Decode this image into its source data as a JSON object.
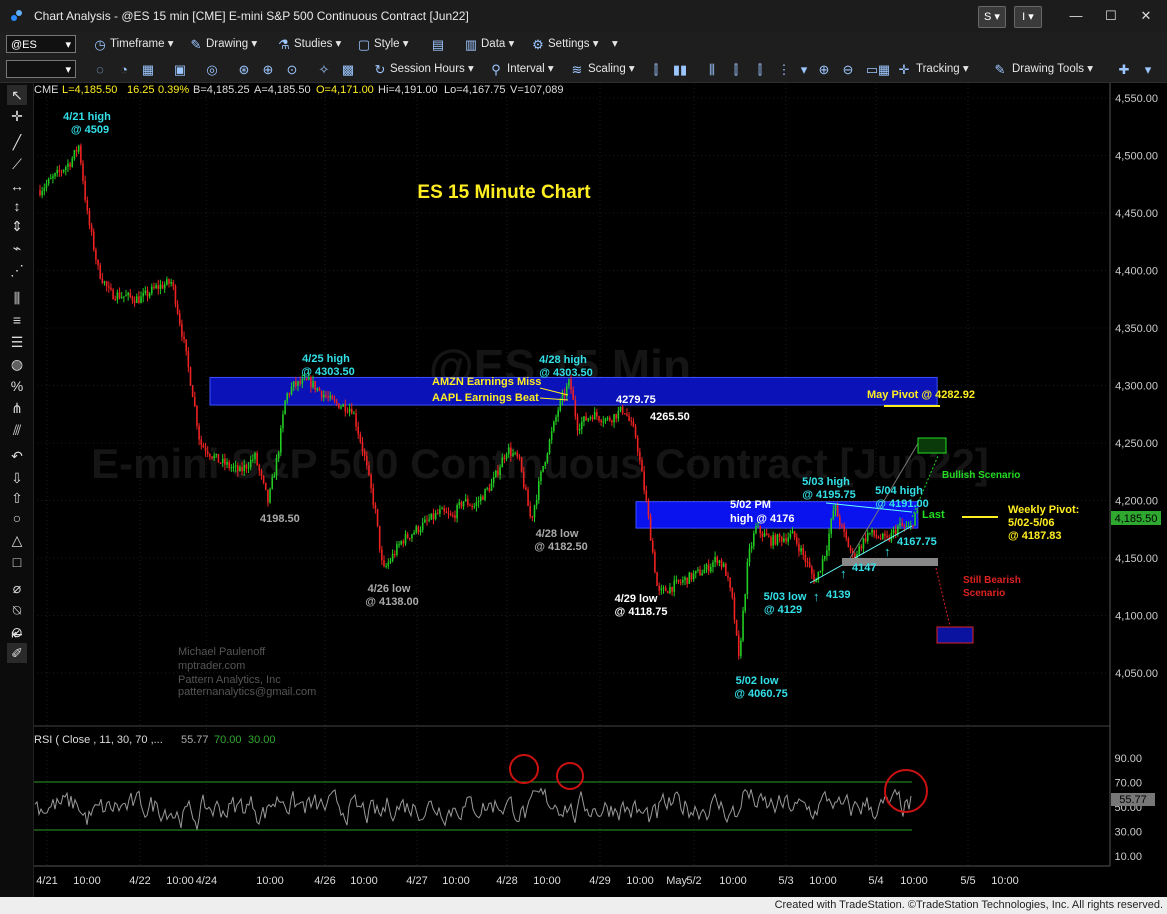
{
  "window": {
    "title": "Chart Analysis - @ES 15 min [CME] E-mini S&P 500 Continuous Contract [Jun22]",
    "s_button": "S",
    "i_button": "I"
  },
  "toolbar1": {
    "symbol": "@ES",
    "timeframe": "Timeframe",
    "drawing": "Drawing",
    "studies": "Studies",
    "style": "Style",
    "data": "Data",
    "settings": "Settings"
  },
  "toolbar2": {
    "session_hours": "Session Hours",
    "interval": "Interval",
    "scaling": "Scaling",
    "tracking": "Tracking",
    "drawing_tools": "Drawing Tools"
  },
  "quote_line": {
    "exchange": "CME",
    "last": "L=4,185.50",
    "change": "16.25",
    "change_pct": "0.39%",
    "bid": "B=4,185.25",
    "ask": "A=4,185.50",
    "open": "O=4,171.00",
    "high": "Hi=4,191.00",
    "low": "Lo=4,167.75",
    "volume": "V=107,089"
  },
  "watermark": {
    "symbol": "@ES 15 Min",
    "name": "E-mini S&P 500 Continuous Contract [Jun22]"
  },
  "author": {
    "line1": "Michael Paulenoff",
    "line2": "mptrader.com",
    "line3": "Pattern Analytics, Inc",
    "line4": "patternanalytics@gmail.com"
  },
  "status": {
    "credit": "Created with TradeStation. ©TradeStation Technologies, Inc. All rights reserved."
  },
  "colors": {
    "up_candle": "#22cc22",
    "down_candle": "#ee2222",
    "zone_blue": "#0a12b8",
    "annotation_cyan": "#33e0e8",
    "annotation_yellow": "#ffee22",
    "annotation_green": "#22dd22",
    "annotation_red": "#dd2222",
    "last_price": "#33cc33"
  },
  "chart_data": {
    "type": "candlestick",
    "title": "ES 15 Minute Chart",
    "ylim": [
      4020,
      4570
    ],
    "y_ticks": [
      "4,550.00",
      "4,500.00",
      "4,450.00",
      "4,400.00",
      "4,350.00",
      "4,300.00",
      "4,250.00",
      "4,200.00",
      "4,150.00",
      "4,100.00",
      "4,050.00"
    ],
    "last_price_label": "4,185.50",
    "x_labels": [
      {
        "x": "4/21",
        "y": "4/21"
      },
      {
        "x": "4/21 10:00",
        "y": "10:00"
      },
      {
        "x": "4/22",
        "y": "4/22"
      },
      {
        "x": "4/22 10:00",
        "y": "10:00"
      },
      {
        "x": "4/24",
        "y": "4/24"
      },
      {
        "x": "4/25 10:00",
        "y": "10:00"
      },
      {
        "x": "4/26",
        "y": "4/26"
      },
      {
        "x": "4/26 10:00",
        "y": "10:00"
      },
      {
        "x": "4/27",
        "y": "4/27"
      },
      {
        "x": "4/27 10:00",
        "y": "10:00"
      },
      {
        "x": "4/28",
        "y": "4/28"
      },
      {
        "x": "4/28 10:00",
        "y": "10:00"
      },
      {
        "x": "4/29",
        "y": "4/29"
      },
      {
        "x": "4/29 10:00",
        "y": "10:00"
      },
      {
        "x": "May",
        "y": "May"
      },
      {
        "x": "5/2",
        "y": "5/2"
      },
      {
        "x": "5/2 10:00",
        "y": "10:00"
      },
      {
        "x": "5/3",
        "y": "5/3"
      },
      {
        "x": "5/3 10:00",
        "y": "10:00"
      },
      {
        "x": "5/4",
        "y": "5/4"
      },
      {
        "x": "5/4 10:00",
        "y": "10:00"
      },
      {
        "x": "5/5",
        "y": "5/5"
      },
      {
        "x": "5/5 10:00",
        "y": "10:00"
      }
    ],
    "price_path": [
      {
        "t": "4/20 23:00",
        "p": 4470
      },
      {
        "t": "4/21 03:00",
        "p": 4485
      },
      {
        "t": "4/21 06:00",
        "p": 4495
      },
      {
        "t": "4/21 08:00",
        "p": 4509
      },
      {
        "t": "4/21 10:00",
        "p": 4450
      },
      {
        "t": "4/21 13:00",
        "p": 4400
      },
      {
        "t": "4/21 16:00",
        "p": 4380
      },
      {
        "t": "4/22 00:00",
        "p": 4375
      },
      {
        "t": "4/22 04:00",
        "p": 4385
      },
      {
        "t": "4/22 08:00",
        "p": 4390
      },
      {
        "t": "4/22 11:00",
        "p": 4340
      },
      {
        "t": "4/22 14:00",
        "p": 4290
      },
      {
        "t": "4/22 16:00",
        "p": 4250
      },
      {
        "t": "4/24 20:00",
        "p": 4235
      },
      {
        "t": "4/25 02:00",
        "p": 4225
      },
      {
        "t": "4/25 06:00",
        "p": 4238
      },
      {
        "t": "4/25 09:30",
        "p": 4198.5
      },
      {
        "t": "4/25 12:00",
        "p": 4240
      },
      {
        "t": "4/25 14:00",
        "p": 4290
      },
      {
        "t": "4/25 16:00",
        "p": 4300
      },
      {
        "t": "4/25 20:00",
        "p": 4303.5
      },
      {
        "t": "4/26 02:00",
        "p": 4285
      },
      {
        "t": "4/26 07:00",
        "p": 4280
      },
      {
        "t": "4/26 10:00",
        "p": 4240
      },
      {
        "t": "4/26 13:00",
        "p": 4190
      },
      {
        "t": "4/26 15:00",
        "p": 4138
      },
      {
        "t": "4/26 20:00",
        "p": 4165
      },
      {
        "t": "4/27 02:00",
        "p": 4180
      },
      {
        "t": "4/27 06:00",
        "p": 4190
      },
      {
        "t": "4/27 09:00",
        "p": 4185
      },
      {
        "t": "4/27 12:00",
        "p": 4200
      },
      {
        "t": "4/27 15:00",
        "p": 4195
      },
      {
        "t": "4/27 20:00",
        "p": 4215
      },
      {
        "t": "4/28 00:00",
        "p": 4245
      },
      {
        "t": "4/28 03:00",
        "p": 4235
      },
      {
        "t": "4/28 06:00",
        "p": 4182.5
      },
      {
        "t": "4/28 09:00",
        "p": 4230
      },
      {
        "t": "4/28 13:00",
        "p": 4280
      },
      {
        "t": "4/28 16:00",
        "p": 4303.5
      },
      {
        "t": "4/28 18:00",
        "p": 4265
      },
      {
        "t": "4/28 22:00",
        "p": 4275
      },
      {
        "t": "4/29 02:00",
        "p": 4270
      },
      {
        "t": "4/29 06:00",
        "p": 4279.75
      },
      {
        "t": "4/29 09:00",
        "p": 4255
      },
      {
        "t": "4/29 12:00",
        "p": 4200
      },
      {
        "t": "4/29 15:00",
        "p": 4140
      },
      {
        "t": "4/29 16:00",
        "p": 4118.75
      },
      {
        "t": "5/2 00:00",
        "p": 4135
      },
      {
        "t": "5/2 03:00",
        "p": 4140
      },
      {
        "t": "5/2 06:00",
        "p": 4150
      },
      {
        "t": "5/2 08:00",
        "p": 4140
      },
      {
        "t": "5/2 10:00",
        "p": 4110
      },
      {
        "t": "5/2 11:30",
        "p": 4060.75
      },
      {
        "t": "5/2 14:00",
        "p": 4150
      },
      {
        "t": "5/2 16:00",
        "p": 4176
      },
      {
        "t": "5/2 20:00",
        "p": 4165
      },
      {
        "t": "5/3 02:00",
        "p": 4170
      },
      {
        "t": "5/3 05:00",
        "p": 4150
      },
      {
        "t": "5/3 08:00",
        "p": 4129
      },
      {
        "t": "5/3 11:00",
        "p": 4160
      },
      {
        "t": "5/3 13:00",
        "p": 4195.75
      },
      {
        "t": "5/3 15:00",
        "p": 4175
      },
      {
        "t": "5/3 18:00",
        "p": 4150
      },
      {
        "t": "5/3 22:00",
        "p": 4172
      },
      {
        "t": "5/4 03:00",
        "p": 4165
      },
      {
        "t": "5/4 06:00",
        "p": 4178
      },
      {
        "t": "5/4 09:00",
        "p": 4175
      },
      {
        "t": "5/4 10:30",
        "p": 4191
      },
      {
        "t": "5/4 11:00",
        "p": 4185.5
      }
    ],
    "price_path_note": "",
    "zones": [
      {
        "name": "4/25-4/28 highs zone",
        "from": "4/24 18:00",
        "to": "5/4 16:00",
        "low": 4283,
        "high": 4307
      },
      {
        "name": "5/02 PM high zone",
        "from": "4/29 09:00",
        "to": "5/4 11:00",
        "low": 4176,
        "high": 4199
      }
    ],
    "annotations": [
      {
        "text": [
          "4/21 high",
          "@ 4509"
        ],
        "color": "cyan"
      },
      {
        "text": [
          "4/25 high",
          "@ 4303.50"
        ],
        "color": "cyan"
      },
      {
        "text": [
          "4/28 high",
          "@ 4303.50"
        ],
        "color": "cyan"
      },
      {
        "text": [
          "AMZN Earnings Miss"
        ],
        "color": "yellow"
      },
      {
        "text": [
          "AAPL Earnings Beat"
        ],
        "color": "yellow"
      },
      {
        "text": [
          "4279.75"
        ],
        "color": "white"
      },
      {
        "text": [
          "4265.50"
        ],
        "color": "white"
      },
      {
        "text": [
          "May Pivot @ 4282.92"
        ],
        "color": "yellow"
      },
      {
        "text": [
          "4198.50"
        ],
        "color": "gray"
      },
      {
        "text": [
          "4/26 low",
          "@ 4138.00"
        ],
        "color": "gray"
      },
      {
        "text": [
          "4/28 low",
          "@ 4182.50"
        ],
        "color": "gray"
      },
      {
        "text": [
          "4/29 low",
          "@ 4118.75"
        ],
        "color": "white"
      },
      {
        "text": [
          "5/02 low",
          "@ 4060.75"
        ],
        "color": "cyan"
      },
      {
        "text": [
          "5/02 PM",
          "high @ 4176"
        ],
        "color": "white"
      },
      {
        "text": [
          "5/03 high",
          "@ 4195.75"
        ],
        "color": "cyan"
      },
      {
        "text": [
          "5/04 high",
          "@ 4191.00"
        ],
        "color": "cyan"
      },
      {
        "text": [
          "Last"
        ],
        "color": "green"
      },
      {
        "text": [
          "4167.75"
        ],
        "color": "cyan"
      },
      {
        "text": [
          "4147"
        ],
        "color": "cyan"
      },
      {
        "text": [
          "4139"
        ],
        "color": "cyan"
      },
      {
        "text": [
          "5/03 low",
          "@ 4129"
        ],
        "color": "cyan"
      },
      {
        "text": [
          "Bullish Scenario"
        ],
        "color": "green"
      },
      {
        "text": [
          "Weekly Pivot:",
          "5/02-5/06",
          "@ 4187.83"
        ],
        "color": "yellow"
      },
      {
        "text": [
          "Still Bearish",
          "Scenario"
        ],
        "color": "red"
      }
    ],
    "rsi": {
      "label": "RSI ( Close , 11, 30, 70 ,...",
      "value": "55.77",
      "overbought": "70.00",
      "oversold": "30.00",
      "ylim": [
        0,
        100
      ],
      "y_ticks": [
        "90.00",
        "70.00",
        "50.00",
        "30.00",
        "10.00"
      ]
    }
  }
}
